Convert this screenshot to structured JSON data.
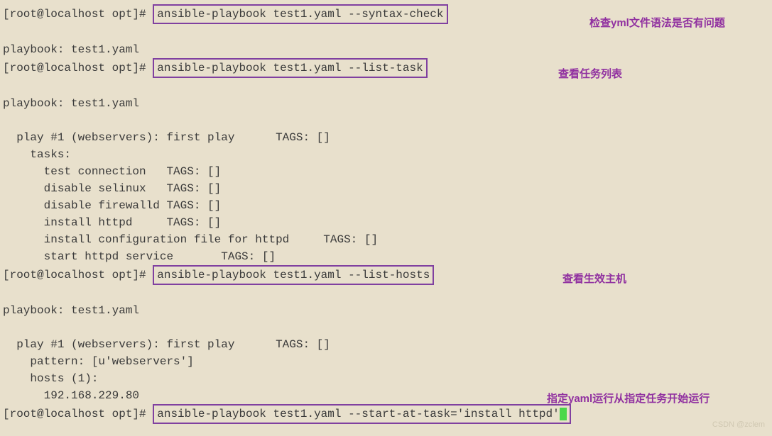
{
  "prompt": "[root@localhost opt]# ",
  "commands": {
    "syntax_check": "ansible-playbook test1.yaml --syntax-check",
    "list_task": "ansible-playbook test1.yaml --list-task",
    "list_hosts": "ansible-playbook test1.yaml --list-hosts",
    "start_at_task": "ansible-playbook test1.yaml --start-at-task='install httpd'"
  },
  "output": {
    "playbook_line": "playbook: test1.yaml",
    "play_header": "  play #1 (webservers): first play      TAGS: []",
    "tasks_label": "    tasks:",
    "tasks": {
      "t1": "      test connection   TAGS: []",
      "t2": "      disable selinux   TAGS: []",
      "t3": "      disable firewalld TAGS: []",
      "t4": "      install httpd     TAGS: []",
      "t5": "      install configuration file for httpd     TAGS: []",
      "t6": "      start httpd service       TAGS: []"
    },
    "hosts": {
      "pattern": "    pattern: [u'webservers']",
      "hosts_count": "    hosts (1):",
      "host1": "      192.168.229.80"
    }
  },
  "annotations": {
    "a1": "检查yml文件语法是否有问题",
    "a2": "查看任务列表",
    "a3": "查看生效主机",
    "a4": "指定yaml运行从指定任务开始运行"
  },
  "watermark": "CSDN @zclem"
}
